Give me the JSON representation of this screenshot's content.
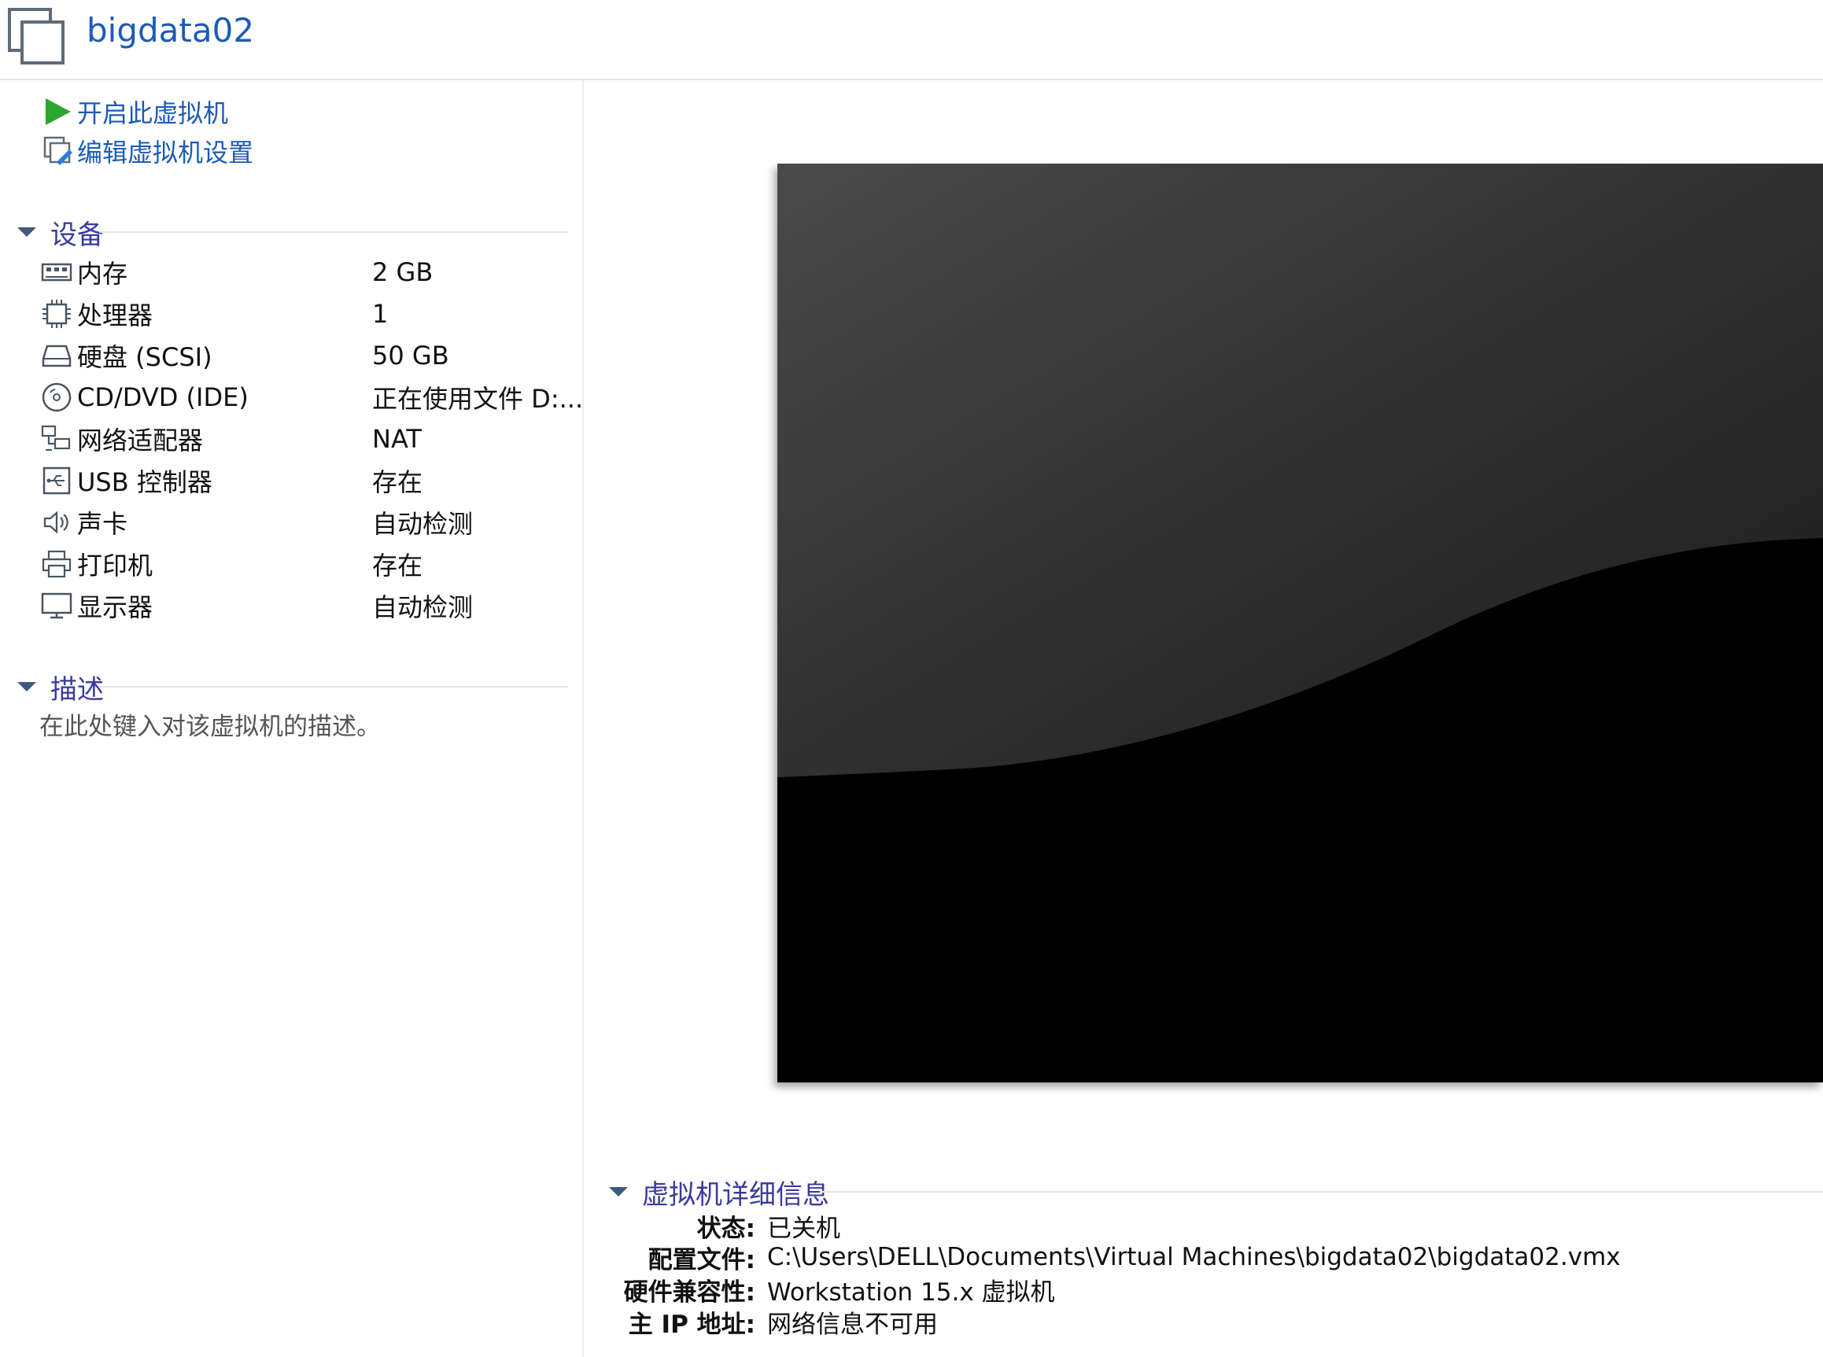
{
  "header": {
    "title": "bigdata02"
  },
  "actions": {
    "power_on": "开启此虚拟机",
    "edit_settings": "编辑虚拟机设置"
  },
  "devices": {
    "heading": "设备",
    "items": [
      {
        "name": "内存",
        "value": "2 GB",
        "icon": "memory-icon"
      },
      {
        "name": "处理器",
        "value": "1",
        "icon": "processor-icon"
      },
      {
        "name": "硬盘 (SCSI)",
        "value": "50 GB",
        "icon": "hard-disk-icon"
      },
      {
        "name": "CD/DVD (IDE)",
        "value": "正在使用文件 D:...",
        "icon": "cd-dvd-icon"
      },
      {
        "name": "网络适配器",
        "value": "NAT",
        "icon": "network-adapter-icon"
      },
      {
        "name": "USB 控制器",
        "value": "存在",
        "icon": "usb-controller-icon"
      },
      {
        "name": "声卡",
        "value": "自动检测",
        "icon": "sound-card-icon"
      },
      {
        "name": "打印机",
        "value": "存在",
        "icon": "printer-icon"
      },
      {
        "name": "显示器",
        "value": "自动检测",
        "icon": "display-icon"
      }
    ]
  },
  "description": {
    "heading": "描述",
    "placeholder": "在此处键入对该虚拟机的描述。"
  },
  "details": {
    "heading": "虚拟机详细信息",
    "rows": [
      {
        "label": "状态:",
        "value": "已关机"
      },
      {
        "label": "配置文件:",
        "value": "C:\\Users\\DELL\\Documents\\Virtual Machines\\bigdata02\\bigdata02.vmx"
      },
      {
        "label": "硬件兼容性:",
        "value": "Workstation 15.x 虚拟机"
      },
      {
        "label": "主 IP 地址:",
        "value": "网络信息不可用"
      }
    ]
  },
  "colors": {
    "link": "#1c5bb5",
    "section": "#3a3aa0",
    "play": "#2ea52e"
  }
}
